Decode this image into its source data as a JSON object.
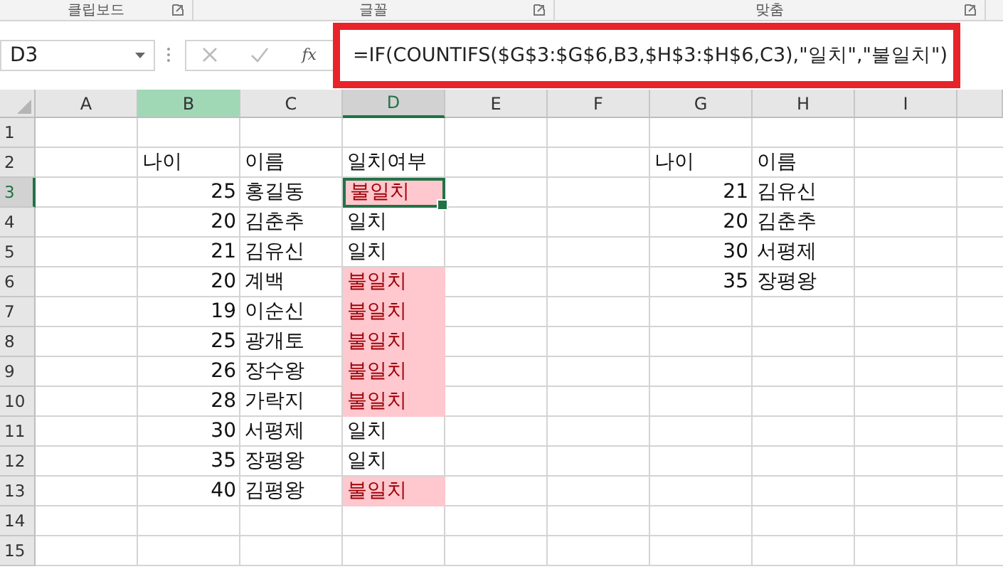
{
  "ribbon": {
    "groups": [
      {
        "label": "클립보드"
      },
      {
        "label": "글꼴"
      },
      {
        "label": "맞춤"
      }
    ]
  },
  "formula_bar": {
    "name_box": "D3",
    "function_button": "fx",
    "formula": "=IF(COUNTIFS($G$3:$G$6,B3,$H$3:$H$6,C3),\"일치\",\"불일치\")",
    "highlighted": true
  },
  "columns": [
    {
      "label": "A",
      "highlighted": false,
      "selected": false
    },
    {
      "label": "B",
      "highlighted": true,
      "selected": false
    },
    {
      "label": "C",
      "highlighted": false,
      "selected": false
    },
    {
      "label": "D",
      "highlighted": false,
      "selected": true
    },
    {
      "label": "E",
      "highlighted": false,
      "selected": false
    },
    {
      "label": "F",
      "highlighted": false,
      "selected": false
    },
    {
      "label": "G",
      "highlighted": false,
      "selected": false
    },
    {
      "label": "H",
      "highlighted": false,
      "selected": false
    },
    {
      "label": "I",
      "highlighted": false,
      "selected": false
    }
  ],
  "row_numbers": [
    {
      "label": "1",
      "selected": false
    },
    {
      "label": "2",
      "selected": false
    },
    {
      "label": "3",
      "selected": true
    },
    {
      "label": "4",
      "selected": false
    },
    {
      "label": "5",
      "selected": false
    },
    {
      "label": "6",
      "selected": false
    },
    {
      "label": "7",
      "selected": false
    },
    {
      "label": "8",
      "selected": false
    },
    {
      "label": "9",
      "selected": false
    },
    {
      "label": "10",
      "selected": false
    },
    {
      "label": "11",
      "selected": false
    },
    {
      "label": "12",
      "selected": false
    },
    {
      "label": "13",
      "selected": false
    },
    {
      "label": "14",
      "selected": false
    },
    {
      "label": "15",
      "selected": false
    }
  ],
  "tables": [
    {
      "columns": [
        {
          "label": "나이",
          "kind": "number"
        },
        {
          "label": "이름",
          "kind": "text"
        },
        {
          "label": "일치여부",
          "kind": "text"
        }
      ],
      "rows": [
        {
          "cells": [
            "25",
            "홍길동",
            "불일치"
          ],
          "mismatch": true,
          "selected": true
        },
        {
          "cells": [
            "20",
            "김춘추",
            "일치"
          ],
          "mismatch": false,
          "selected": false
        },
        {
          "cells": [
            "21",
            "김유신",
            "일치"
          ],
          "mismatch": false,
          "selected": false
        },
        {
          "cells": [
            "20",
            "계백",
            "불일치"
          ],
          "mismatch": true,
          "selected": false
        },
        {
          "cells": [
            "19",
            "이순신",
            "불일치"
          ],
          "mismatch": true,
          "selected": false
        },
        {
          "cells": [
            "25",
            "광개토",
            "불일치"
          ],
          "mismatch": true,
          "selected": false
        },
        {
          "cells": [
            "26",
            "장수왕",
            "불일치"
          ],
          "mismatch": true,
          "selected": false
        },
        {
          "cells": [
            "28",
            "가락지",
            "불일치"
          ],
          "mismatch": true,
          "selected": false
        },
        {
          "cells": [
            "30",
            "서평제",
            "일치"
          ],
          "mismatch": false,
          "selected": false
        },
        {
          "cells": [
            "35",
            "장평왕",
            "일치"
          ],
          "mismatch": false,
          "selected": false
        },
        {
          "cells": [
            "40",
            "김평왕",
            "불일치"
          ],
          "mismatch": true,
          "selected": false
        }
      ]
    },
    {
      "columns": [
        {
          "label": "나이",
          "kind": "number"
        },
        {
          "label": "이름",
          "kind": "text"
        }
      ],
      "rows": [
        {
          "cells": [
            "21",
            "김유신"
          ]
        },
        {
          "cells": [
            "20",
            "김춘추"
          ]
        },
        {
          "cells": [
            "30",
            "서평제"
          ]
        },
        {
          "cells": [
            "35",
            "장평왕"
          ]
        }
      ]
    }
  ]
}
